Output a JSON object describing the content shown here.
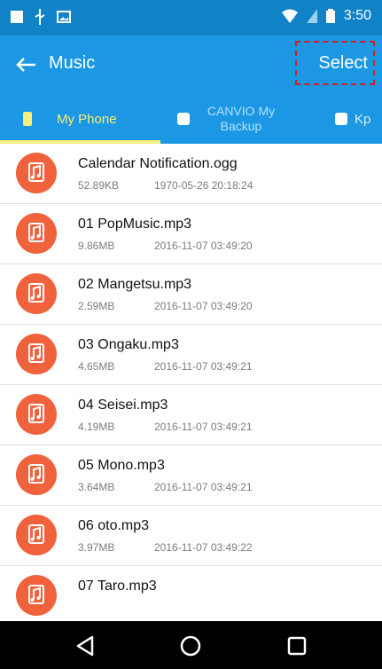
{
  "status_bar": {
    "time": "3:50"
  },
  "app_bar": {
    "title": "Music",
    "select_label": "Select"
  },
  "tabs": [
    {
      "label": "My Phone"
    },
    {
      "label": "CANVIO My Backup"
    },
    {
      "label": "Kp"
    }
  ],
  "files": [
    {
      "name": "Calendar Notification.ogg",
      "size": "52.89KB",
      "date": "1970-05-26 20:18:24"
    },
    {
      "name": "01 PopMusic.mp3",
      "size": "9.86MB",
      "date": "2016-11-07 03:49:20"
    },
    {
      "name": "02 Mangetsu.mp3",
      "size": "2.59MB",
      "date": "2016-11-07 03:49:20"
    },
    {
      "name": "03 Ongaku.mp3",
      "size": "4.65MB",
      "date": "2016-11-07 03:49:21"
    },
    {
      "name": "04 Seisei.mp3",
      "size": "4.19MB",
      "date": "2016-11-07 03:49:21"
    },
    {
      "name": "05 Mono.mp3",
      "size": "3.64MB",
      "date": "2016-11-07 03:49:21"
    },
    {
      "name": "06 oto.mp3",
      "size": "3.97MB",
      "date": "2016-11-07 03:49:22"
    },
    {
      "name": "07 Taro.mp3",
      "size": "",
      "date": ""
    }
  ],
  "icons": {
    "back": "arrow-left-icon",
    "file": "music-note-icon",
    "nav": [
      "back-triangle-icon",
      "home-circle-icon",
      "recents-square-icon"
    ]
  }
}
